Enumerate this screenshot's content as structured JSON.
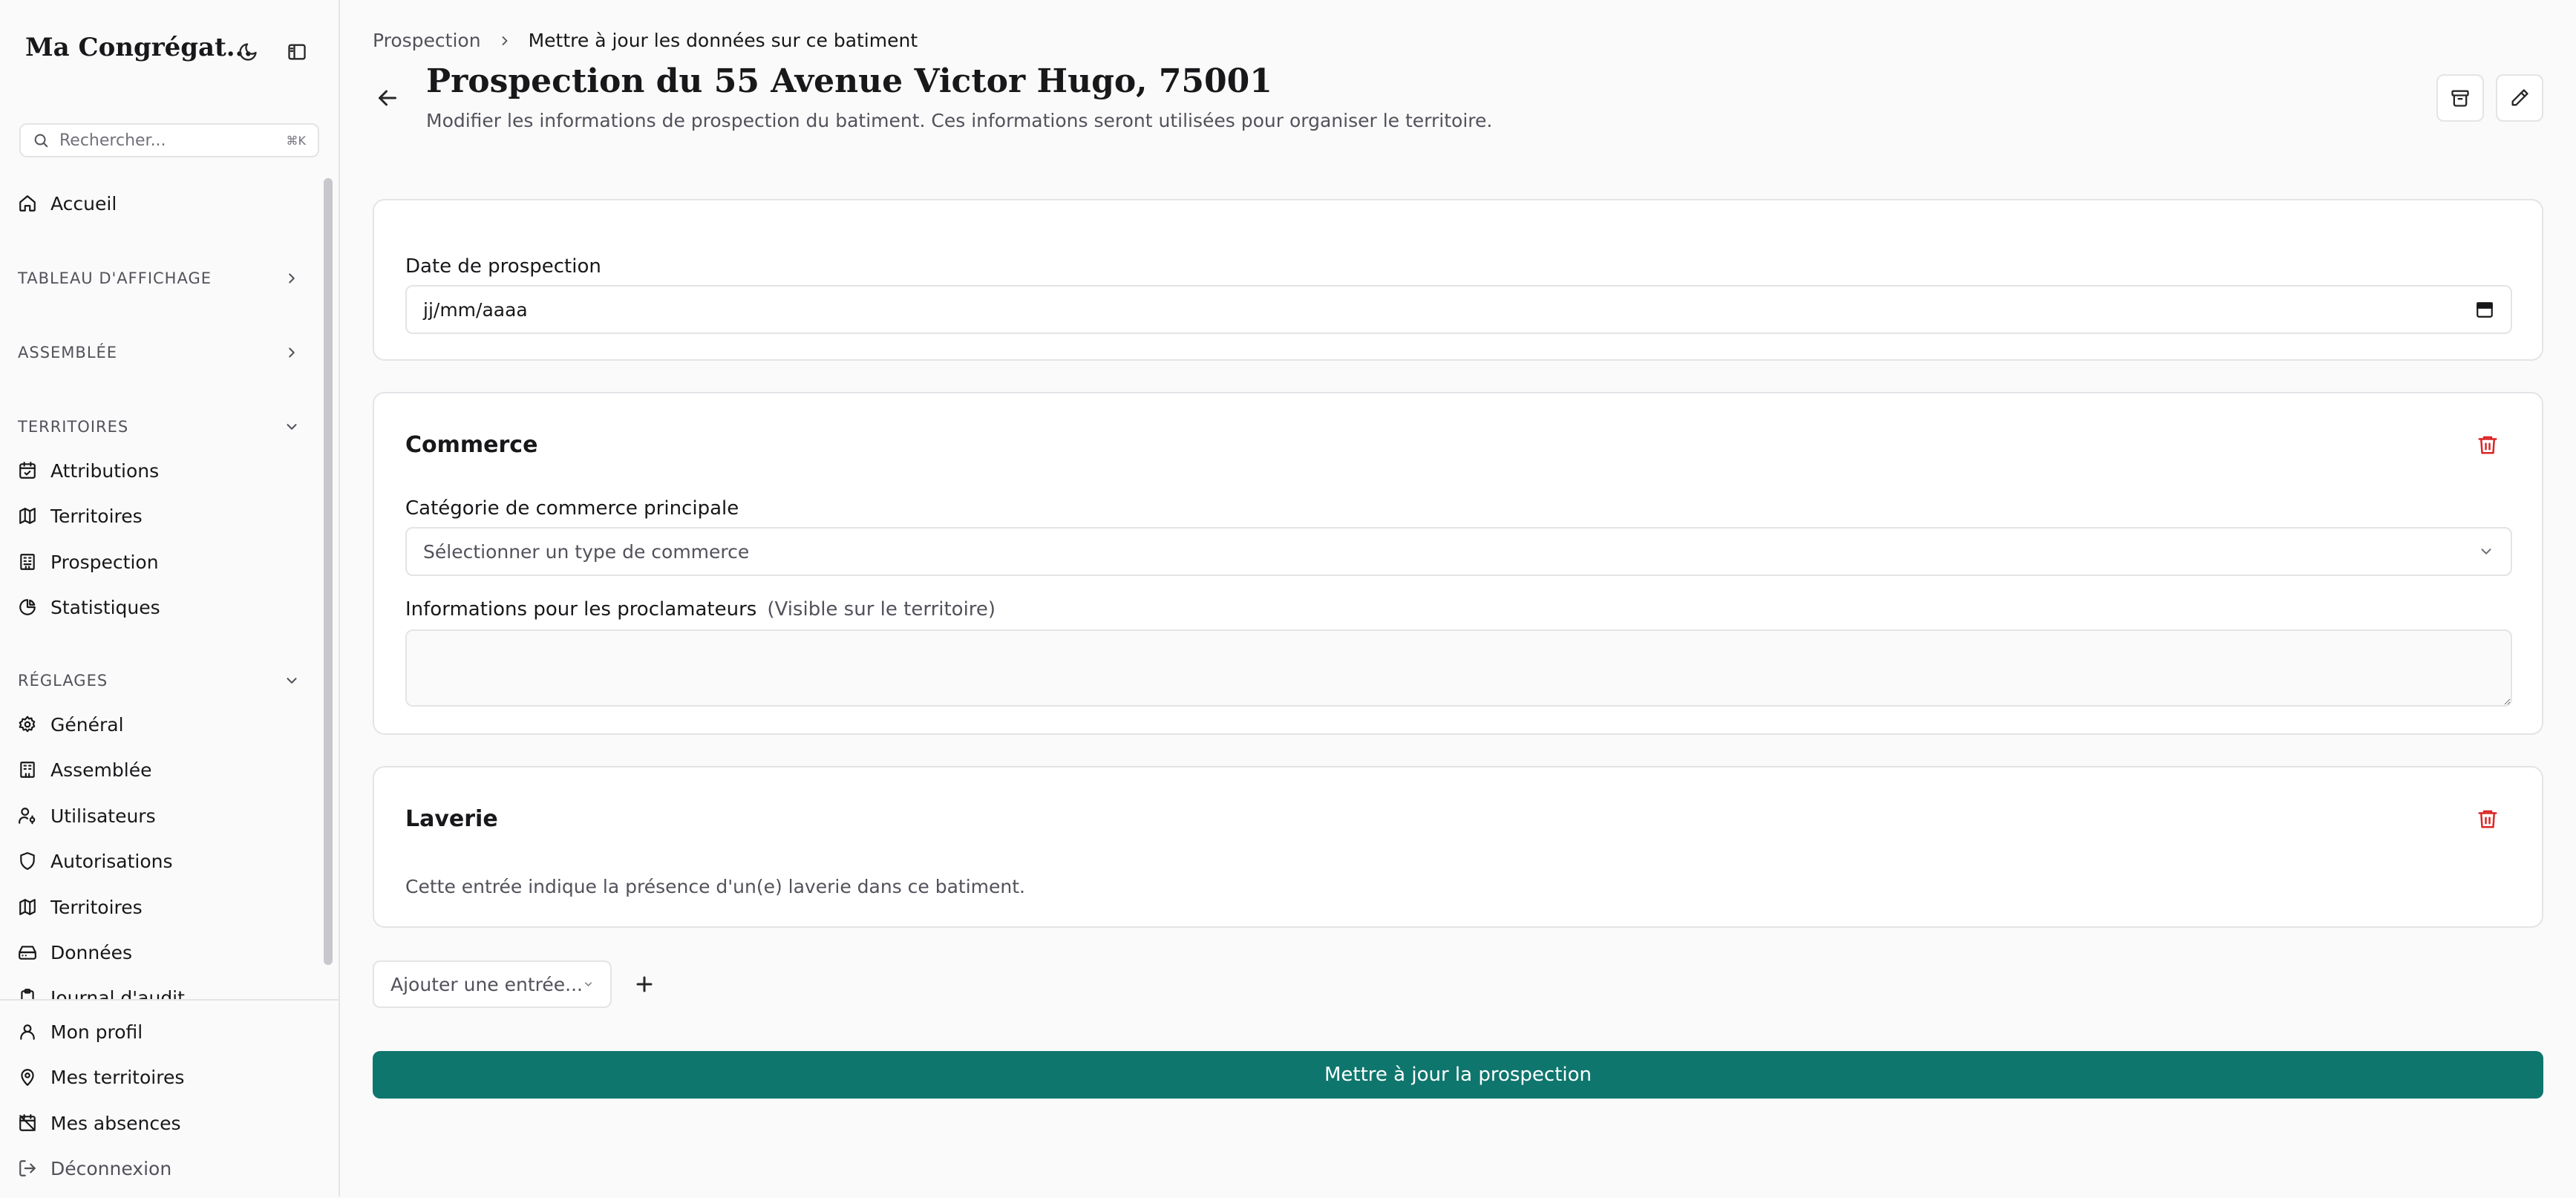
{
  "app": {
    "brand": "Ma Congrégat..."
  },
  "search": {
    "placeholder": "Rechercher...",
    "shortcut": "⌘K"
  },
  "nav": {
    "home": "Accueil",
    "sections": {
      "tableau": "TABLEAU D'AFFICHAGE",
      "assemblee": "ASSEMBLÉE",
      "territoires": "TERRITOIRES",
      "reglages": "RÉGLAGES"
    },
    "territoires_items": [
      "Attributions",
      "Territoires",
      "Prospection",
      "Statistiques"
    ],
    "reglages_items": [
      "Général",
      "Assemblée",
      "Utilisateurs",
      "Autorisations",
      "Territoires",
      "Données",
      "Journal d'audit"
    ]
  },
  "footer": {
    "items": [
      "Mon profil",
      "Mes territoires",
      "Mes absences",
      "Déconnexion"
    ]
  },
  "breadcrumb": {
    "parent": "Prospection",
    "current": "Mettre à jour les données sur ce batiment"
  },
  "page": {
    "title": "Prospection du 55 Avenue Victor Hugo, 75001",
    "subtitle": "Modifier les informations de prospection du batiment. Ces informations seront utilisées pour organiser le territoire."
  },
  "date_card": {
    "label": "Date de prospection",
    "placeholder": "jj/mm/aaaa"
  },
  "commerce_card": {
    "title": "Commerce",
    "category_label": "Catégorie de commerce principale",
    "category_placeholder": "Sélectionner un type de commerce",
    "info_label": "Informations pour les proclamateurs",
    "info_hint": "(Visible sur le territoire)",
    "info_value": ""
  },
  "laverie_card": {
    "title": "Laverie",
    "description": "Cette entrée indique la présence d'un(e) laverie dans ce batiment."
  },
  "add_entry": {
    "label": "Ajouter une entrée..."
  },
  "submit": {
    "label": "Mettre à jour la prospection"
  },
  "colors": {
    "primary": "#0f766e",
    "danger": "#dc2626",
    "border": "#e4e4e7"
  }
}
